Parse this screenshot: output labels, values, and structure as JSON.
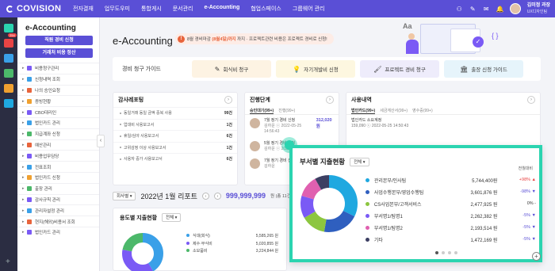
{
  "brand": "COVISION",
  "topmenu": [
    "전자결재",
    "업무도우미",
    "통합게시",
    "문서관리",
    "e-Accounting",
    "협업스페이스",
    "그룹웨어 관리"
  ],
  "active_menu": "e-Accounting",
  "user": {
    "name": "김미정 과장",
    "role": "UX디자인팀"
  },
  "rail_badge": "254",
  "sidebar": {
    "title": "e-Accounting",
    "btn1": "직원 경비 신청",
    "btn2": "거래처 비용 정산",
    "items": [
      {
        "label": "비용청구관리",
        "color": "#7a5af5"
      },
      {
        "label": "신청내역 조회",
        "color": "#3aa0e8"
      },
      {
        "label": "나의 승인요청",
        "color": "#e8643c"
      },
      {
        "label": "증빙현황",
        "color": "#f0a030"
      },
      {
        "label": "CBO대리인",
        "color": "#7a5af5"
      },
      {
        "label": "법인카드 관리",
        "color": "#3aa0e8"
      },
      {
        "label": "지급계좌 신청",
        "color": "#4cb86a"
      },
      {
        "label": "예산관리",
        "color": "#e8643c"
      },
      {
        "label": "비용업무담당",
        "color": "#7a5af5"
      },
      {
        "label": "전표조회",
        "color": "#3aa0e8"
      },
      {
        "label": "법인카드 신청",
        "color": "#f0a030"
      },
      {
        "label": "출장 관리",
        "color": "#4cb86a"
      },
      {
        "label": "감사규칙 관리",
        "color": "#7a5af5"
      },
      {
        "label": "관리자설정 관리",
        "color": "#3aa0e8"
      },
      {
        "label": "현지(해외)비용서 조회",
        "color": "#e8643c"
      },
      {
        "label": "법인카드 관리",
        "color": "#7a5af5"
      }
    ]
  },
  "page_title": "e-Accounting",
  "notice": {
    "pre": "8월 경비마감",
    "highlight": "(8월4일)까지",
    "post": "까지 · 프로젝트관련 비용은 프로젝트 경비로 신청!"
  },
  "guide": {
    "label": "경비 청구 가이드",
    "buttons": [
      {
        "label": "회식비 청구",
        "icon": "✎",
        "bg": "#fdf3e3"
      },
      {
        "label": "자기개발비 신청",
        "icon": "💡",
        "bg": "#fdf7e0"
      },
      {
        "label": "프로젝트 경비 청구",
        "icon": "🖌",
        "bg": "#eeecfb"
      },
      {
        "label": "출장 신청 가이드",
        "icon": "🏛",
        "bg": "#e6f4fb"
      }
    ]
  },
  "audit": {
    "title": "감사레포팅",
    "rows": [
      {
        "label": "동일거래 동일 금액 중복 사용",
        "value": "99건"
      },
      {
        "label": "업대비 사용보고서",
        "value": "1건"
      },
      {
        "label": "휴일/심야 사용보고서",
        "value": "6건"
      },
      {
        "label": "고위감정 이상 사용보고서",
        "value": "1건"
      },
      {
        "label": "사용자 중가 사용보고서",
        "value": "6건"
      }
    ]
  },
  "progress": {
    "title": "진행단계",
    "tabs": [
      "승인대기(99+)",
      "진행(99+)"
    ],
    "items": [
      {
        "line1": "7월 정기 경비 신청",
        "line2": "김하운 ⓒ 2022-05-25 14:56:43",
        "amount": "312,020원"
      },
      {
        "line1": "5월 정기 경비 신청",
        "line2": "김하운 ⓒ 2022-05-25 14:56:43",
        "amount": ""
      },
      {
        "line1": "7월 정기 경비 신청",
        "line2": "김하운",
        "amount": ""
      }
    ]
  },
  "usage": {
    "title": "사용내역",
    "tabs": [
      "법인카드(99+)",
      "세금계산서(99+)",
      "영수증(99+)"
    ],
    "item": {
      "line1": "법인카드 소요계정",
      "line2": "159,090 ⓒ 2022-05-25 14:50:43"
    }
  },
  "report": {
    "select": "회사별",
    "title": "2022년 1월 리포트",
    "amount": "999,999,999",
    "unit": "원 (총 11건)"
  },
  "purpose": {
    "title": "용도별 지출현황",
    "select": "전체",
    "rows": [
      {
        "label": "식대(회식)",
        "value": "5,585,265 원",
        "color": "#3aa0e8"
      },
      {
        "label": "제수·부식비",
        "value": "5,020,855 원",
        "color": "#7a5af5"
      },
      {
        "label": "소모품비",
        "value": "3,224,844 원",
        "color": "#4cb86a"
      }
    ]
  },
  "chart_data": {
    "type": "pie",
    "title": "부서별 지출현황",
    "select": "전체",
    "change_header": "전월대비",
    "categories": [
      "관리본부/인사팀",
      "사업수행본부/영업수행팀",
      "CS사업본부/고객서비스",
      "부서명1/팀명1",
      "부서명1/팀명2",
      "기타"
    ],
    "values": [
      5744400,
      3601876,
      2477925,
      2262382,
      2193514,
      1472169
    ],
    "labels": [
      "5,744,400원",
      "3,601,876 원",
      "2,477,925 원",
      "2,262,382 원",
      "2,193,514 원",
      "1,472,169 원"
    ],
    "changes": [
      "+98% ▲",
      "-98% ▼",
      "0% -",
      "-5% ▼",
      "-5% ▼",
      "-5% ▼"
    ],
    "change_colors": [
      "#e84444",
      "#5a4fd6",
      "#333333",
      "#5a4fd6",
      "#5a4fd6",
      "#5a4fd6"
    ],
    "colors": [
      "#1fa8e0",
      "#2f5fbf",
      "#8cc63f",
      "#7a5af5",
      "#e060b0",
      "#3c3f63"
    ]
  }
}
